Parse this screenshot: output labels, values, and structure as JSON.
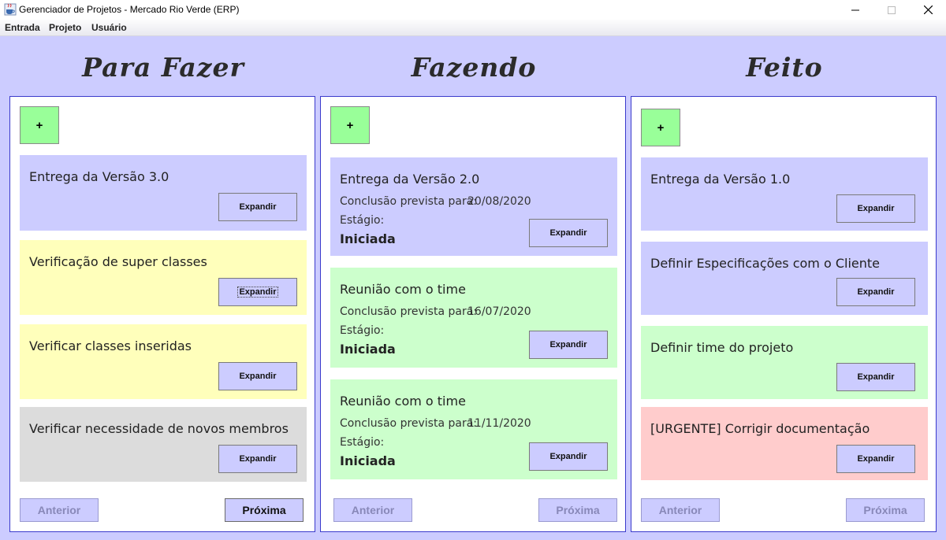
{
  "window": {
    "title": "Gerenciador de Projetos - Mercado Rio Verde (ERP)"
  },
  "menu": [
    "Entrada",
    "Projeto",
    "Usuário"
  ],
  "columns": [
    {
      "heading": "Para Fazer",
      "add_label": "+",
      "cards": [
        {
          "title": "Entrega da Versão 3.0",
          "color": "#ccccff",
          "button": "Expandir"
        },
        {
          "title": "Verificação de super classes",
          "color": "#ffffbb",
          "button": "Expandir"
        },
        {
          "title": "Verificar classes inseridas",
          "color": "#ffffbb",
          "button": "Expandir"
        },
        {
          "title": "Verificar necessidade de novos membros",
          "color": "#dcdcdc",
          "button": "Expandir"
        }
      ],
      "prev_label": "Anterior",
      "next_label": "Próxima"
    },
    {
      "heading": "Fazendo",
      "add_label": "+",
      "cards": [
        {
          "title": "Entrega da Versão 2.0",
          "due_label": "Conclusão prevista para:",
          "due_date": "20/08/2020",
          "stage_label": "Estágio:",
          "stage": "Iniciada",
          "color": "#ccccff",
          "button": "Expandir"
        },
        {
          "title": "Reunião com o time",
          "due_label": "Conclusão prevista para:",
          "due_date": "16/07/2020",
          "stage_label": "Estágio:",
          "stage": "Iniciada",
          "color": "#ccffcc",
          "button": "Expandir"
        },
        {
          "title": "Reunião com o time",
          "due_label": "Conclusão prevista para:",
          "due_date": "11/11/2020",
          "stage_label": "Estágio:",
          "stage": "Iniciada",
          "color": "#ccffcc",
          "button": "Expandir"
        }
      ],
      "prev_label": "Anterior",
      "next_label": "Próxima"
    },
    {
      "heading": "Feito",
      "add_label": "+",
      "cards": [
        {
          "title": "Entrega da Versão 1.0",
          "color": "#ccccff",
          "button": "Expandir"
        },
        {
          "title": "Definir Especificações com o Cliente",
          "color": "#ccccff",
          "button": "Expandir"
        },
        {
          "title": "Definir time do projeto",
          "color": "#ccffcc",
          "button": "Expandir"
        },
        {
          "title": "[URGENTE] Corrigir documentação",
          "color": "#ffcccc",
          "button": "Expandir"
        }
      ],
      "prev_label": "Anterior",
      "next_label": "Próxima"
    }
  ],
  "colors": {
    "background": "#ccccff",
    "add_button": "#99ff99",
    "column_border": "#3a3acc"
  }
}
